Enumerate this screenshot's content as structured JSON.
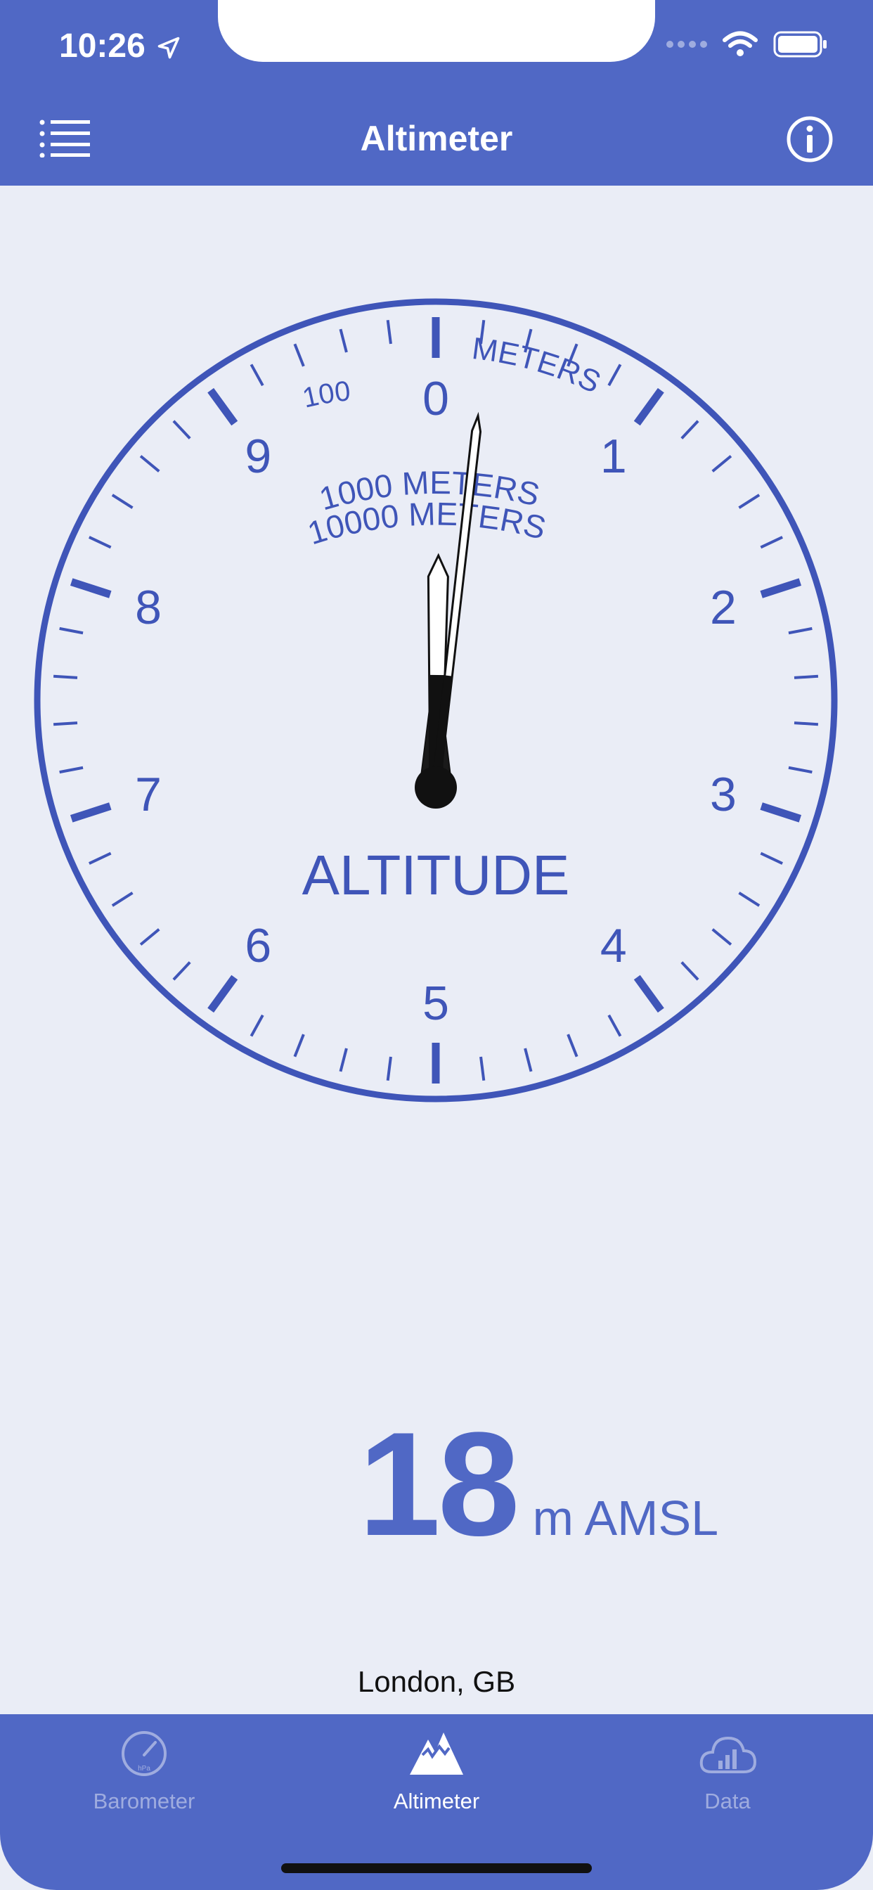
{
  "status_bar": {
    "time": "10:26"
  },
  "nav": {
    "title": "Altimeter"
  },
  "gauge": {
    "numbers": [
      "0",
      "1",
      "2",
      "3",
      "4",
      "5",
      "6",
      "7",
      "8",
      "9"
    ],
    "label_100": "100",
    "label_meters": "METERS",
    "label_1000": "1000 METERS",
    "label_10000": "10000 METERS",
    "title": "ALTITUDE",
    "altitude_m": 18,
    "color": "#3f55b8"
  },
  "readout": {
    "value": "18",
    "unit": "m AMSL"
  },
  "location": "London, GB",
  "tabs": [
    {
      "label": "Barometer",
      "icon": "gauge-icon",
      "icon_text": "hPa"
    },
    {
      "label": "Altimeter",
      "icon": "mountain-icon"
    },
    {
      "label": "Data",
      "icon": "cloud-chart-icon"
    }
  ],
  "colors": {
    "brand": "#5068c5",
    "background": "#eaedf6"
  }
}
